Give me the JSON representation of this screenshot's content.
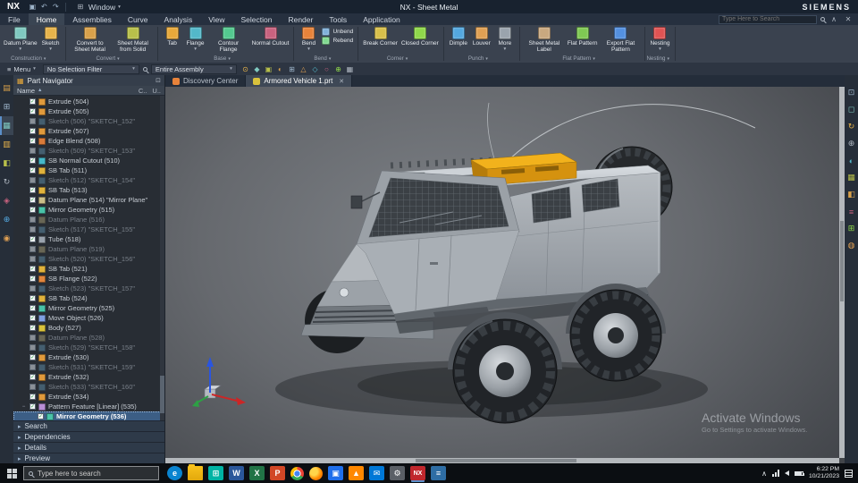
{
  "titlebar": {
    "app": "NX",
    "title": "NX - Sheet Metal",
    "brand": "SIEMENS",
    "window_menu": "Window",
    "search_placeholder": "Type Here to Search"
  },
  "quick_access": [
    {
      "name": "save-icon",
      "glyph": "▣"
    },
    {
      "name": "undo-icon",
      "glyph": "↶"
    },
    {
      "name": "redo-icon",
      "glyph": "↷"
    }
  ],
  "menu_tabs": [
    {
      "label": "File",
      "active": false
    },
    {
      "label": "Home",
      "active": true
    },
    {
      "label": "Assemblies",
      "active": false
    },
    {
      "label": "Curve",
      "active": false
    },
    {
      "label": "Analysis",
      "active": false
    },
    {
      "label": "View",
      "active": false
    },
    {
      "label": "Selection",
      "active": false
    },
    {
      "label": "Render",
      "active": false
    },
    {
      "label": "Tools",
      "active": false
    },
    {
      "label": "Application",
      "active": false
    }
  ],
  "ribbon": {
    "groups": [
      {
        "name": "Construction",
        "buttons": [
          {
            "label": "Datum Plane",
            "icon": "datum-plane-icon",
            "color": "#7fc9c0",
            "dropdown": true
          },
          {
            "label": "Sketch",
            "icon": "sketch-icon",
            "color": "#e8b44a",
            "dropdown": true
          }
        ]
      },
      {
        "name": "Convert",
        "buttons": [
          {
            "label": "Convert to Sheet Metal",
            "icon": "convert-to-sheet-metal-icon",
            "color": "#d9a14a"
          },
          {
            "label": "Sheet Metal from Solid",
            "icon": "sheet-metal-from-solid-icon",
            "color": "#b8c04a"
          }
        ]
      },
      {
        "name": "Base",
        "buttons": [
          {
            "label": "Tab",
            "icon": "tab-icon",
            "color": "#e8a93a"
          },
          {
            "label": "Flange",
            "icon": "flange-icon",
            "color": "#53b8c9",
            "dropdown": true
          },
          {
            "label": "Contour Flange",
            "icon": "contour-flange-icon",
            "color": "#53c98f"
          },
          {
            "label": "Normal Cutout",
            "icon": "normal-cutout-icon",
            "color": "#c9627f"
          }
        ]
      },
      {
        "name": "Bend",
        "buttons": [
          {
            "label": "Bend",
            "icon": "bend-icon",
            "color": "#e8833a",
            "dropdown": true
          },
          {
            "stack": [
              {
                "label": "Unbend",
                "icon": "unbend-icon",
                "color": "#7fb0d9"
              },
              {
                "label": "Rebend",
                "icon": "rebend-icon",
                "color": "#7fd98f"
              }
            ]
          }
        ]
      },
      {
        "name": "Corner",
        "buttons": [
          {
            "label": "Break Corner",
            "icon": "break-corner-icon",
            "color": "#d9c04a"
          },
          {
            "label": "Closed Corner",
            "icon": "closed-corner-icon",
            "color": "#8fd94a"
          }
        ]
      },
      {
        "name": "Punch",
        "buttons": [
          {
            "label": "Dimple",
            "icon": "dimple-icon",
            "color": "#53a8e0"
          },
          {
            "label": "Louver",
            "icon": "louver-icon",
            "color": "#e0a053"
          },
          {
            "label": "More",
            "icon": "more-icon",
            "color": "#9aa3ad",
            "dropdown": true
          }
        ]
      },
      {
        "name": "Flat Pattern",
        "buttons": [
          {
            "label": "Sheet Metal Label",
            "icon": "sheet-metal-label-icon",
            "color": "#c9a87f"
          },
          {
            "label": "Flat Pattern",
            "icon": "flat-pattern-icon",
            "color": "#7fc953"
          },
          {
            "label": "Export Flat Pattern",
            "icon": "export-flat-pattern-icon",
            "color": "#5390e0"
          }
        ]
      },
      {
        "name": "Nesting",
        "buttons": [
          {
            "label": "Nesting",
            "icon": "nesting-icon",
            "color": "#e05353",
            "dropdown": true
          }
        ]
      }
    ]
  },
  "toolbar": {
    "menu_label": "Menu",
    "selection_filter": "No Selection Filter",
    "scope": "Entire Assembly",
    "snap_icons": [
      {
        "name": "snap-point-icon",
        "glyph": "⊙",
        "color": "#e8b44a"
      },
      {
        "name": "snap-endpoint-icon",
        "glyph": "◆",
        "color": "#7fc9c0"
      },
      {
        "name": "snap-midpoint-icon",
        "glyph": "▣",
        "color": "#b8c04a"
      },
      {
        "name": "snap-center-icon",
        "glyph": "◐",
        "color": "#d9a14a"
      },
      {
        "name": "snap-intersection-icon",
        "glyph": "⊞",
        "color": "#9fb6cc"
      },
      {
        "name": "snap-vertex-icon",
        "glyph": "△",
        "color": "#e0a053"
      },
      {
        "name": "snap-quadrant-icon",
        "glyph": "◇",
        "color": "#53b8c9"
      },
      {
        "name": "snap-node-icon",
        "glyph": "○",
        "color": "#c9627f"
      },
      {
        "name": "snap-grid-icon",
        "glyph": "⊕",
        "color": "#8fd94a"
      },
      {
        "name": "snap-face-icon",
        "glyph": "▦",
        "color": "#aeb6c0"
      }
    ]
  },
  "resource_bar_left": [
    {
      "name": "assembly-navigator-icon",
      "glyph": "▤",
      "color": "#d9a14a",
      "active": false
    },
    {
      "name": "constraint-navigator-icon",
      "glyph": "⊞",
      "color": "#9fb6cc",
      "active": false
    },
    {
      "name": "part-navigator-icon",
      "glyph": "▦",
      "color": "#7fc9c0",
      "active": true
    },
    {
      "name": "reuse-library-icon",
      "glyph": "▥",
      "color": "#e8b44a",
      "active": false
    },
    {
      "name": "view-manager-icon",
      "glyph": "◧",
      "color": "#b8c04a",
      "active": false
    },
    {
      "name": "history-icon",
      "glyph": "↻",
      "color": "#aeb6c0",
      "active": false
    },
    {
      "name": "process-studio-icon",
      "glyph": "◈",
      "color": "#c9627f",
      "active": false
    },
    {
      "name": "manufacturing-icon",
      "glyph": "⊕",
      "color": "#53a8e0",
      "active": false
    },
    {
      "name": "roles-icon",
      "glyph": "◉",
      "color": "#e0a053",
      "active": false
    }
  ],
  "resource_bar_right": [
    {
      "name": "fit-view-icon",
      "glyph": "⊡",
      "color": "#9fb6cc"
    },
    {
      "name": "zoom-icon",
      "glyph": "◻",
      "color": "#7fc9c0"
    },
    {
      "name": "rotate-view-icon",
      "glyph": "↻",
      "color": "#e8b44a"
    },
    {
      "name": "pan-icon",
      "glyph": "⊕",
      "color": "#aeb6c0"
    },
    {
      "name": "shaded-mode-icon",
      "glyph": "◐",
      "color": "#53b8c9"
    },
    {
      "name": "wireframe-mode-icon",
      "glyph": "▦",
      "color": "#b8c04a"
    },
    {
      "name": "perspective-icon",
      "glyph": "◧",
      "color": "#d9a14a"
    },
    {
      "name": "section-view-icon",
      "glyph": "≡",
      "color": "#c9627f"
    },
    {
      "name": "window-layout-icon",
      "glyph": "⊞",
      "color": "#8fd94a"
    },
    {
      "name": "render-style-icon",
      "glyph": "◍",
      "color": "#e0a053"
    }
  ],
  "part_navigator": {
    "title": "Part Navigator",
    "columns": {
      "name": "Name",
      "c": "C..",
      "u": "U.."
    },
    "icon_colors": {
      "extrude": "#e09a3c",
      "sketch": "#6fa8c9",
      "edge-blend": "#d97b3a",
      "cutout": "#46b8c9",
      "tab": "#e0b23c",
      "datum": "#c9bd88",
      "mirror": "#49c2a8",
      "tube": "#9aa3ad",
      "flange": "#e0853c",
      "move": "#7f9fe0",
      "body": "#d9c23c",
      "pattern": "#b98fd6"
    },
    "items": [
      {
        "label": "Extrude (504)",
        "type": "extrude"
      },
      {
        "label": "Extrude (505)",
        "type": "extrude"
      },
      {
        "label": "Sketch (506) \"SKETCH_152\"",
        "type": "sketch",
        "dimmed": true
      },
      {
        "label": "Extrude (507)",
        "type": "extrude"
      },
      {
        "label": "Edge Blend (508)",
        "type": "edge-blend"
      },
      {
        "label": "Sketch (509) \"SKETCH_153\"",
        "type": "sketch",
        "dimmed": true
      },
      {
        "label": "SB Normal Cutout (510)",
        "type": "cutout"
      },
      {
        "label": "SB Tab (511)",
        "type": "tab"
      },
      {
        "label": "Sketch (512) \"SKETCH_154\"",
        "type": "sketch",
        "dimmed": true
      },
      {
        "label": "SB Tab (513)",
        "type": "tab"
      },
      {
        "label": "Datum Plane (514) \"Mirror Plane\"",
        "type": "datum"
      },
      {
        "label": "Mirror Geometry (515)",
        "type": "mirror"
      },
      {
        "label": "Datum Plane (516)",
        "type": "datum",
        "dimmed": true
      },
      {
        "label": "Sketch (517) \"SKETCH_155\"",
        "type": "sketch",
        "dimmed": true
      },
      {
        "label": "Tube (518)",
        "type": "tube"
      },
      {
        "label": "Datum Plane (519)",
        "type": "datum",
        "dimmed": true
      },
      {
        "label": "Sketch (520) \"SKETCH_156\"",
        "type": "sketch",
        "dimmed": true
      },
      {
        "label": "SB Tab (521)",
        "type": "tab"
      },
      {
        "label": "SB Flange (522)",
        "type": "flange"
      },
      {
        "label": "Sketch (523) \"SKETCH_157\"",
        "type": "sketch",
        "dimmed": true
      },
      {
        "label": "SB Tab (524)",
        "type": "tab"
      },
      {
        "label": "Mirror Geometry (525)",
        "type": "mirror"
      },
      {
        "label": "Move Object (526)",
        "type": "move"
      },
      {
        "label": "Body (527)",
        "type": "body"
      },
      {
        "label": "Datum Plane (528)",
        "type": "datum",
        "dimmed": true
      },
      {
        "label": "Sketch (529) \"SKETCH_158\"",
        "type": "sketch",
        "dimmed": true
      },
      {
        "label": "Extrude (530)",
        "type": "extrude"
      },
      {
        "label": "Sketch (531) \"SKETCH_159\"",
        "type": "sketch",
        "dimmed": true
      },
      {
        "label": "Extrude (532)",
        "type": "extrude"
      },
      {
        "label": "Sketch (533) \"SKETCH_160\"",
        "type": "sketch",
        "dimmed": true
      },
      {
        "label": "Extrude (534)",
        "type": "extrude"
      },
      {
        "label": "Pattern Feature [Linear] (535)",
        "type": "pattern",
        "expander": true
      },
      {
        "label": "Mirror Geometry (536)",
        "type": "mirror",
        "selected": true,
        "indent": 1
      }
    ],
    "panels": [
      "Search",
      "Dependencies",
      "Details",
      "Preview"
    ]
  },
  "viewport": {
    "tabs": [
      {
        "label": "Discovery Center",
        "icon": "discovery-center-icon",
        "icon_color": "#e8833a",
        "active": false
      },
      {
        "label": "Armored Vehicle 1.prt",
        "icon": "part-file-icon",
        "icon_color": "#d9c23c",
        "active": true,
        "closable": true
      }
    ],
    "watermark": {
      "line1": "Activate Windows",
      "line2": "Go to Settings to activate Windows."
    }
  },
  "taskbar": {
    "search_placeholder": "Type here to search",
    "icons": [
      {
        "name": "edge-icon",
        "glyph": "e",
        "bg": "#0a84d0",
        "round": true
      },
      {
        "name": "file-explorer-icon",
        "cls": "ic-folder"
      },
      {
        "name": "store-icon",
        "glyph": "⊞",
        "bg": "#00b3a4"
      },
      {
        "name": "word-icon",
        "glyph": "W",
        "bg": "#2b579a"
      },
      {
        "name": "excel-icon",
        "glyph": "X",
        "bg": "#217346"
      },
      {
        "name": "powerpoint-icon",
        "glyph": "P",
        "bg": "#d24726"
      },
      {
        "name": "chrome-icon",
        "cls": "ic-chrome"
      },
      {
        "name": "firefox-icon",
        "cls": "ic-firefox"
      },
      {
        "name": "photos-icon",
        "glyph": "▣",
        "bg": "#1f6feb"
      },
      {
        "name": "vlc-icon",
        "glyph": "▲",
        "bg": "#ff8800"
      },
      {
        "name": "mail-icon",
        "glyph": "✉",
        "bg": "#0078d7"
      },
      {
        "name": "settings-icon",
        "glyph": "⚙",
        "bg": "#5a5f66"
      },
      {
        "name": "nx-icon",
        "glyph": "NX",
        "bg": "#c0272d",
        "active": true
      },
      {
        "name": "notepad-icon",
        "glyph": "≡",
        "bg": "#2e6da4"
      }
    ],
    "time": "6:22 PM",
    "date": "10/21/2023"
  },
  "glyphs": {
    "caret": "▾",
    "check": "✓",
    "close": "✕",
    "minus": "−",
    "sort": "▲",
    "arrow": "▸",
    "menu": "≡",
    "window": "⊞",
    "chevron_up": "∧",
    "pin": "⊡"
  }
}
